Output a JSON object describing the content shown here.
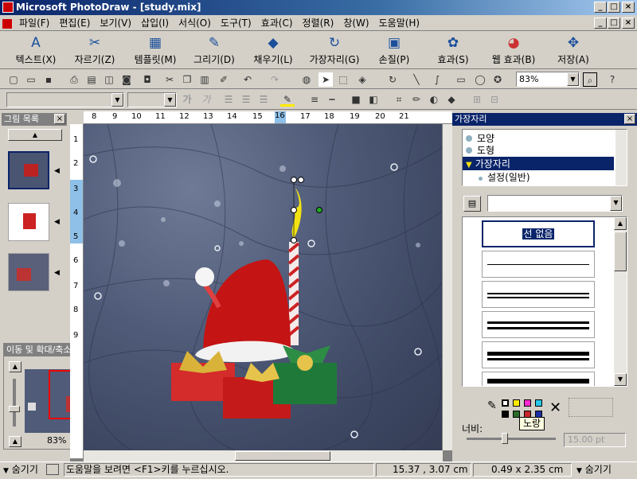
{
  "window": {
    "title": "Microsoft PhotoDraw - [study.mix]",
    "controls": [
      "_",
      "□",
      "×"
    ]
  },
  "menu": [
    "파일(F)",
    "편집(E)",
    "보기(V)",
    "삽입(I)",
    "서식(O)",
    "도구(T)",
    "효과(C)",
    "정렬(R)",
    "창(W)",
    "도움말(H)"
  ],
  "big_toolbar": [
    {
      "label": "텍스트(X)",
      "icon": "text-icon"
    },
    {
      "label": "자르기(Z)",
      "icon": "scissors-icon"
    },
    {
      "label": "템플릿(M)",
      "icon": "template-icon"
    },
    {
      "label": "그리기(D)",
      "icon": "draw-icon"
    },
    {
      "label": "채우기(L)",
      "icon": "fill-icon"
    },
    {
      "label": "가장자리(G)",
      "icon": "edge-icon"
    },
    {
      "label": "손질(P)",
      "icon": "touchup-icon"
    },
    {
      "label": "효과(S)",
      "icon": "effects-icon"
    },
    {
      "label": "웹 효과(B)",
      "icon": "web-effects-icon"
    },
    {
      "label": "저장(A)",
      "icon": "save-icon"
    }
  ],
  "zoom_combo": "83%",
  "left_panel": {
    "title": "그림 목록"
  },
  "nav_panel": {
    "title": "이동 및 확대/축소",
    "zoom": "83%"
  },
  "ruler": {
    "h_ticks": [
      "8",
      "9",
      "10",
      "11",
      "12",
      "13",
      "14",
      "15",
      "16",
      "17",
      "18",
      "19",
      "20",
      "21"
    ],
    "v_ticks": [
      "1",
      "2",
      "3",
      "4",
      "5",
      "6",
      "7",
      "8",
      "9"
    ]
  },
  "right_panel": {
    "title": "가장자리",
    "tree": [
      {
        "label": "모양",
        "selected": false
      },
      {
        "label": "도형",
        "selected": false
      },
      {
        "label": "가장자리",
        "selected": true
      },
      {
        "label": "설정(일반)",
        "selected": false
      }
    ],
    "first_line_label": "선 없음",
    "tooltip": "노랑",
    "width_label": "너비:",
    "width_value": "15.00 pt"
  },
  "status": {
    "hide_left": "숨기기",
    "help_text": "도움말을 보려면 <F1>키를 누르십시오.",
    "position": "15.37 , 3.07  cm",
    "size": "0.49 x 2.35  cm",
    "hide_right": "숨기기"
  },
  "colors": {
    "title_start": "#0a246a",
    "title_end": "#a6caf0",
    "selection": "#0a246a",
    "face": "#d4d0c8"
  }
}
